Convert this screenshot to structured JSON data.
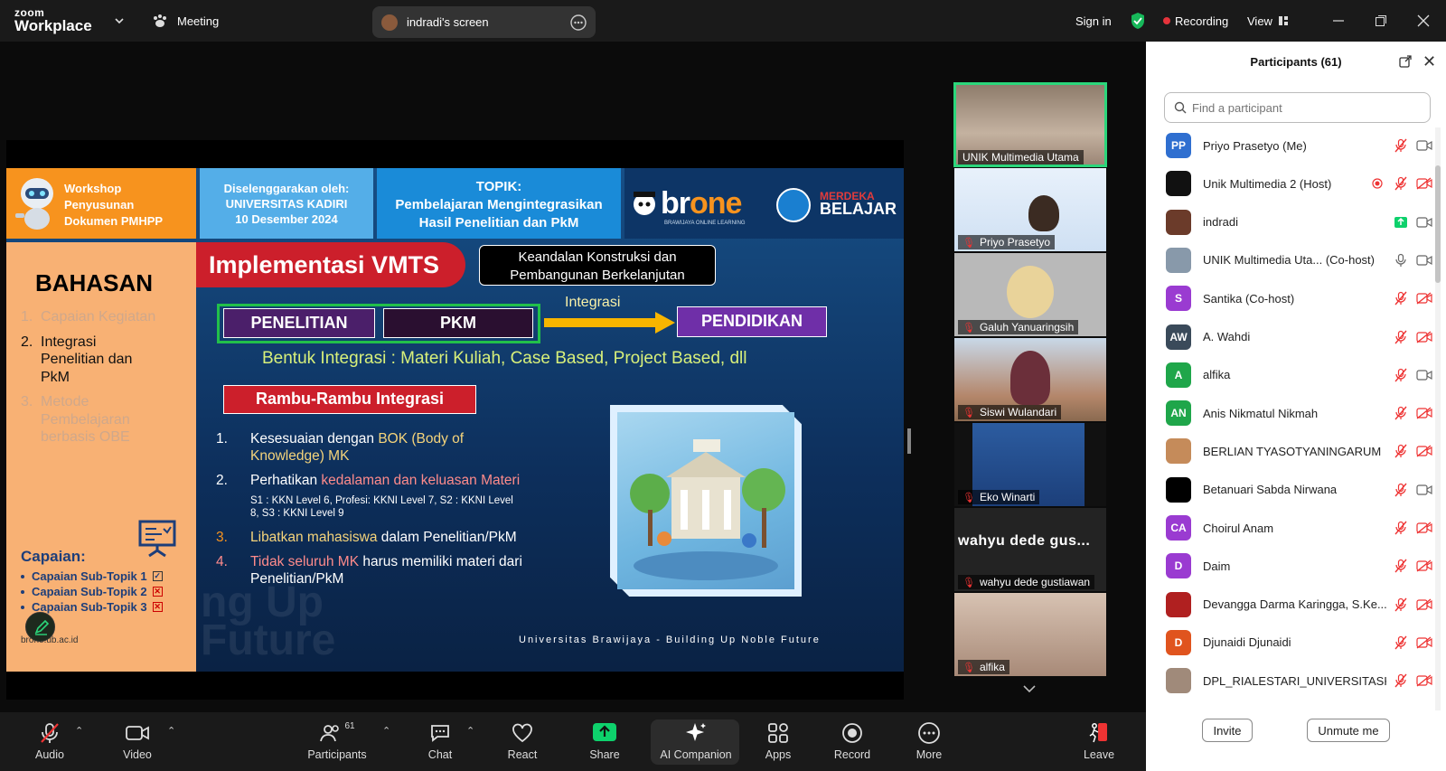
{
  "app": {
    "brand_top": "zoom",
    "brand_bottom": "Workplace",
    "meeting_label": "Meeting"
  },
  "screen_share": {
    "label": "indradi's screen"
  },
  "topbar": {
    "sign_in": "Sign in",
    "recording": "Recording",
    "view": "View"
  },
  "colors": {
    "accent_green": "#2bd67b",
    "recording_red": "#e5333b",
    "share_green": "#0ed16c"
  },
  "slide": {
    "workshop": [
      "Workshop",
      "Penyusunan",
      "Dokumen PMHPP"
    ],
    "organizer": [
      "Diselenggarakan oleh:",
      "UNIVERSITAS KADIRI",
      "10 Desember 2024"
    ],
    "topic": [
      "TOPIK:",
      "Pembelajaran Mengintegrasikan",
      "Hasil Penelitian dan PkM"
    ],
    "brone": {
      "br": "br",
      "one": "one",
      "sub": "BRAWIJAYA ONLINE LEARNING"
    },
    "merdeka": {
      "top": "MERDEKA",
      "bottom": "BELAJAR"
    },
    "bahasan": "BAHASAN",
    "agenda": [
      {
        "n": "1.",
        "text": "Capaian Kegiatan"
      },
      {
        "n": "2.",
        "text": "Integrasi Penelitian dan PkM"
      },
      {
        "n": "3.",
        "text": "Metode Pembelajaran berbasis OBE"
      }
    ],
    "capaian_title": "Capaian:",
    "capaian": [
      "Capaian Sub-Topik 1",
      "Capaian Sub-Topik 2",
      "Capaian Sub-Topik 3"
    ],
    "url": "brone.ub.ac.id",
    "impl_title": "Implementasi VMTS",
    "keandalan": [
      "Keandalan Konstruksi dan",
      "Pembangunan Berkelanjutan"
    ],
    "penelitian": "PENELITIAN",
    "pkm": "PKM",
    "integrasi": "Integrasi",
    "pendidikan": "PENDIDIKAN",
    "bentuk": "Bentuk Integrasi : Materi Kuliah, Case Based, Project Based, dll",
    "rambu": "Rambu-Rambu Integrasi",
    "items": {
      "n1": "1.",
      "i1a": "Kesesuaian dengan ",
      "i1b": "BOK (Body of Knowledge) MK",
      "n2": "2.",
      "i2a": "Perhatikan ",
      "i2b": "kedalaman dan keluasan Materi",
      "i2c": "S1 : KKN Level 6, Profesi: KKNI Level 7, S2 : KKNI Level 8, S3 : KKNI Level 9",
      "n3": "3.",
      "i3a": "Libatkan mahasiswa",
      "i3b": " dalam Penelitian/PkM",
      "n4": "4.",
      "i4a": "Tidak seluruh MK",
      "i4b": " harus memiliki materi dari Penelitian/PkM"
    },
    "footer": "Universitas Brawijaya - Building Up Noble Future",
    "ghost": [
      "ng Up",
      "Future"
    ]
  },
  "thumbnails": [
    {
      "name": "UNIK Multimedia Utama",
      "muted": false
    },
    {
      "name": "Priyo Prasetyo",
      "muted": true
    },
    {
      "name": "Galuh Yanuaringsih",
      "muted": true
    },
    {
      "name": "Siswi Wulandari",
      "muted": true
    },
    {
      "name": "Eko Winarti",
      "muted": true
    },
    {
      "name": "wahyu dede gustiawan",
      "muted": true,
      "big_name": "wahyu dede gus..."
    },
    {
      "name": "alfika",
      "muted": true
    }
  ],
  "participants_panel": {
    "title": "Participants (61)",
    "search_placeholder": "Find a participant",
    "invite": "Invite",
    "unmute_me": "Unmute me",
    "list": [
      {
        "initials": "PP",
        "name": "Priyo Prasetyo (Me)",
        "color": "#2f6fd0",
        "mic": "muted",
        "video": "on"
      },
      {
        "initials": "",
        "name": "Unik Multimedia 2 (Host)",
        "color": "#111111",
        "mic": "muted",
        "video": "off",
        "rec": true
      },
      {
        "initials": "",
        "name": "indradi",
        "color": "#6b3b2a",
        "mic": "share",
        "video": "on"
      },
      {
        "initials": "",
        "name": "UNIK Multimedia Uta...  (Co-host)",
        "color": "#8899aa",
        "mic": "on",
        "video": "on"
      },
      {
        "initials": "S",
        "name": "Santika (Co-host)",
        "color": "#9a3bd1",
        "mic": "muted",
        "video": "off"
      },
      {
        "initials": "AW",
        "name": "A. Wahdi",
        "color": "#3a4a5a",
        "mic": "muted",
        "video": "off"
      },
      {
        "initials": "A",
        "name": "alfika",
        "color": "#1fa64a",
        "mic": "muted",
        "video": "on"
      },
      {
        "initials": "AN",
        "name": "Anis Nikmatul Nikmah",
        "color": "#1fa64a",
        "mic": "muted",
        "video": "off"
      },
      {
        "initials": "",
        "name": "BERLIAN TYASOTYANINGARUM",
        "color": "#c58b5a",
        "mic": "muted",
        "video": "off"
      },
      {
        "initials": "",
        "name": "Betanuari Sabda Nirwana",
        "color": "#000000",
        "mic": "muted",
        "video": "on"
      },
      {
        "initials": "CA",
        "name": "Choirul Anam",
        "color": "#9a3bd1",
        "mic": "muted",
        "video": "off"
      },
      {
        "initials": "D",
        "name": "Daim",
        "color": "#9a3bd1",
        "mic": "muted",
        "video": "off"
      },
      {
        "initials": "",
        "name": "Devangga Darma Karingga, S.Ke...",
        "color": "#b02020",
        "mic": "muted",
        "video": "off"
      },
      {
        "initials": "D",
        "name": "Djunaidi Djunaidi",
        "color": "#e0541e",
        "mic": "muted",
        "video": "off"
      },
      {
        "initials": "",
        "name": "DPL_RIALESTARI_UNIVERSITASK...",
        "color": "#a08a7a",
        "mic": "muted",
        "video": "off"
      }
    ]
  },
  "toolbar": {
    "audio": "Audio",
    "video": "Video",
    "participants": "Participants",
    "participants_count": "61",
    "chat": "Chat",
    "react": "React",
    "share": "Share",
    "ai_companion": "AI Companion",
    "apps": "Apps",
    "record": "Record",
    "more": "More",
    "leave": "Leave"
  }
}
